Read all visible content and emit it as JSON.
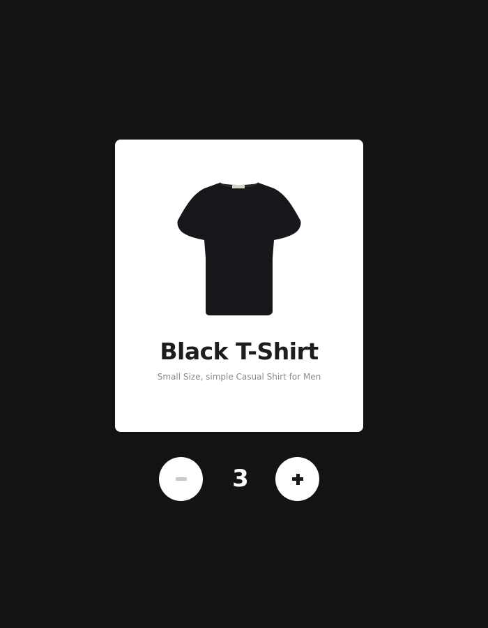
{
  "product": {
    "title": "Black T-Shirt",
    "description": "Small Size, simple Casual Shirt for Men",
    "image_icon": "tshirt-icon",
    "shirt_color": "#17171c"
  },
  "quantity": {
    "value": "3",
    "decrement_icon": "minus-icon",
    "increment_icon": "plus-icon"
  },
  "colors": {
    "background": "#131313",
    "card": "#ffffff",
    "title": "#1d1d1d",
    "description": "#8a8a8a",
    "minus_disabled": "#c9c9c9"
  }
}
